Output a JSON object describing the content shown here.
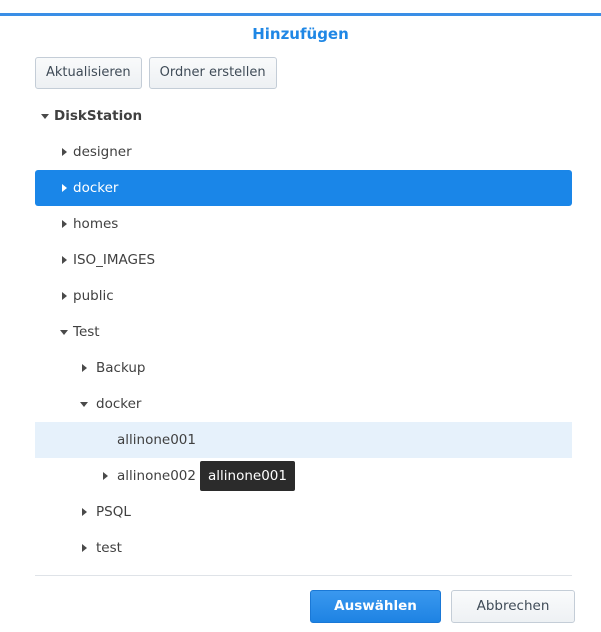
{
  "dialog": {
    "title": "Hinzufügen"
  },
  "toolbar": {
    "refresh_label": "Aktualisieren",
    "create_folder_label": "Ordner erstellen"
  },
  "tree": {
    "root": "DiskStation",
    "items": [
      {
        "label": "designer"
      },
      {
        "label": "docker"
      },
      {
        "label": "homes"
      },
      {
        "label": "ISO_IMAGES"
      },
      {
        "label": "public"
      },
      {
        "label": "Test"
      },
      {
        "label": "Backup"
      },
      {
        "label": "docker"
      },
      {
        "label": "allinone001"
      },
      {
        "label": "allinone002"
      },
      {
        "label": "PSQL"
      },
      {
        "label": "test"
      }
    ]
  },
  "tooltip": {
    "text": "allinone001"
  },
  "footer": {
    "select_label": "Auswählen",
    "cancel_label": "Abbrechen"
  },
  "colors": {
    "accent": "#1a86e8",
    "title": "#1f87e5",
    "hover_row": "#e6f1fb"
  }
}
